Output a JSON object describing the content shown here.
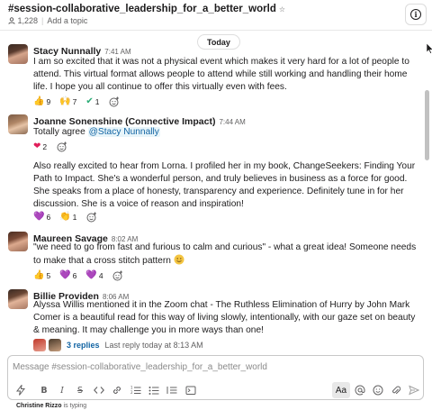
{
  "header": {
    "channel": "#session-collaborative_leadership_for_a_better_world",
    "member_count": "1,228",
    "add_topic": "Add a topic"
  },
  "date_divider": "Today",
  "messages": [
    {
      "author": "Stacy Nunnally",
      "time": "7:41 AM",
      "text": "I am so excited that it was not a physical event which makes it very hard for a lot of people to attend. This virtual format allows people to attend while still working and handling their home life. I hope you all continue to offer this virtually even with fees.",
      "reactions": [
        {
          "emoji": "👍",
          "count": "9"
        },
        {
          "emoji": "🙌",
          "count": "7"
        },
        {
          "emoji": "✔",
          "count": "1"
        }
      ]
    },
    {
      "author": "Joanne Sonenshine (Connective Impact)",
      "time": "7:44 AM",
      "text_before_mention": "Totally agree ",
      "mention": "@Stacy Nunnally",
      "reactions": [
        {
          "emoji": "❤",
          "count": "2"
        }
      ],
      "text2": "Also really excited to hear from Lorna. I profiled her in my book, ChangeSeekers: Finding Your Path to Impact. She's a wonderful person, and truly believes in business as a force for good. She speaks from a place of honesty, transparency and experience. Definitely tune in for her discussion. She is a voice of reason and inspiration!",
      "reactions2": [
        {
          "emoji": "💜",
          "count": "6"
        },
        {
          "emoji": "👏",
          "count": "1"
        }
      ]
    },
    {
      "author": "Maureen Savage",
      "time": "8:02 AM",
      "text": "\"we need to go from fast and furious to calm and curious\" - what a great idea! Someone needs to make that a cross stitch pattern",
      "reactions": [
        {
          "emoji": "👍",
          "count": "5"
        },
        {
          "emoji": "💜",
          "count": "6"
        },
        {
          "emoji": "💜",
          "count": "4"
        }
      ]
    },
    {
      "author": "Billie Providen",
      "time": "8:06 AM",
      "text": "Alyssa Willis mentioned it in the Zoom chat - The Ruthless Elimination of Hurry by John Mark Comer is a beautiful read for this way of living slowly, intentionally, with our gaze set on beauty & meaning. It may challenge you in more ways than one!",
      "thread": {
        "replies": "3 replies",
        "last_reply": "Last reply today at 8:13 AM"
      }
    }
  ],
  "composer": {
    "placeholder": "Message #session-collaborative_leadership_for_a_better_world",
    "format_label": "Aa"
  },
  "typing": {
    "name": "Christine Rizzo",
    "suffix": " is typing"
  },
  "colors": {
    "link": "#1264a3",
    "mention_bg": "#e8f5fa",
    "muted": "#616061"
  }
}
